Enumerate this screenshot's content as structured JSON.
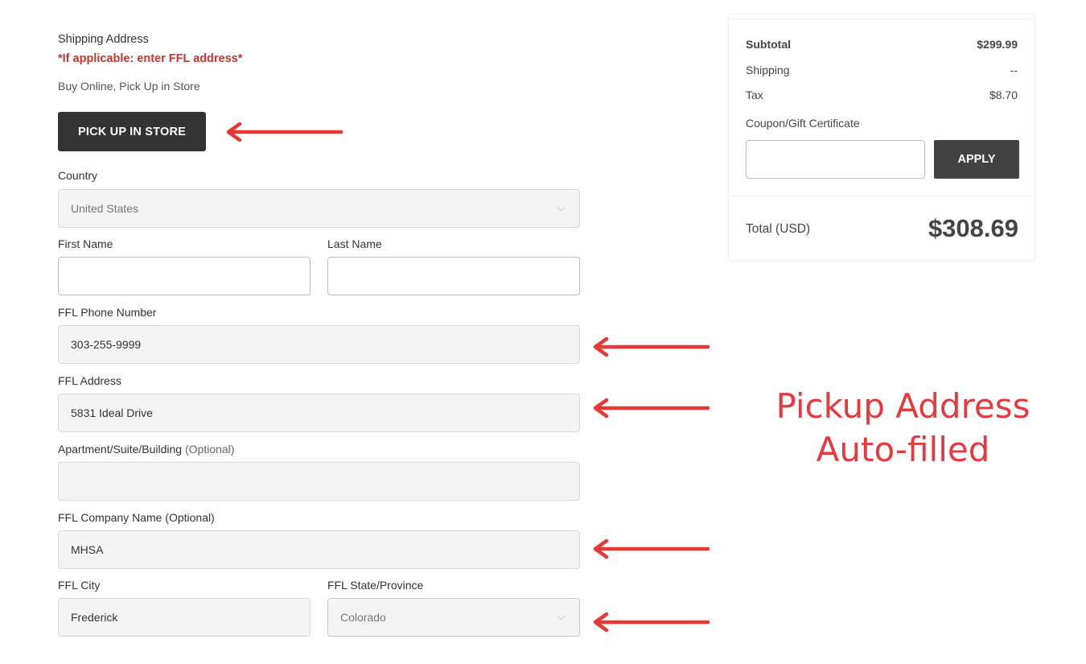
{
  "shipping": {
    "title": "Shipping Address",
    "ffl_note": "*If applicable: enter FFL address*",
    "bopis_text": "Buy Online, Pick Up in Store",
    "pickup_button": "PICK UP IN STORE"
  },
  "fields": {
    "country": {
      "label": "Country",
      "value": "United States"
    },
    "first_name": {
      "label": "First Name",
      "value": ""
    },
    "last_name": {
      "label": "Last Name",
      "value": ""
    },
    "phone": {
      "label": "FFL Phone Number",
      "value": "303-255-9999"
    },
    "address": {
      "label": "FFL Address",
      "value": "5831 Ideal Drive"
    },
    "apartment": {
      "label": "Apartment/Suite/Building",
      "optional": "(Optional)",
      "value": ""
    },
    "company": {
      "label": "FFL Company Name (Optional)",
      "value": "MHSA"
    },
    "city": {
      "label": "FFL City",
      "value": "Frederick"
    },
    "state": {
      "label": "FFL State/Province",
      "value": "Colorado"
    }
  },
  "summary": {
    "subtotal_label": "Subtotal",
    "subtotal_value": "$299.99",
    "shipping_label": "Shipping",
    "shipping_value": "--",
    "tax_label": "Tax",
    "tax_value": "$8.70",
    "coupon_label": "Coupon/Gift Certificate",
    "coupon_value": "",
    "apply_button": "APPLY",
    "total_label": "Total (USD)",
    "total_value": "$308.69"
  },
  "annotation": {
    "line1": "Pickup Address",
    "line2": "Auto-filled",
    "color": "#e53a40"
  }
}
